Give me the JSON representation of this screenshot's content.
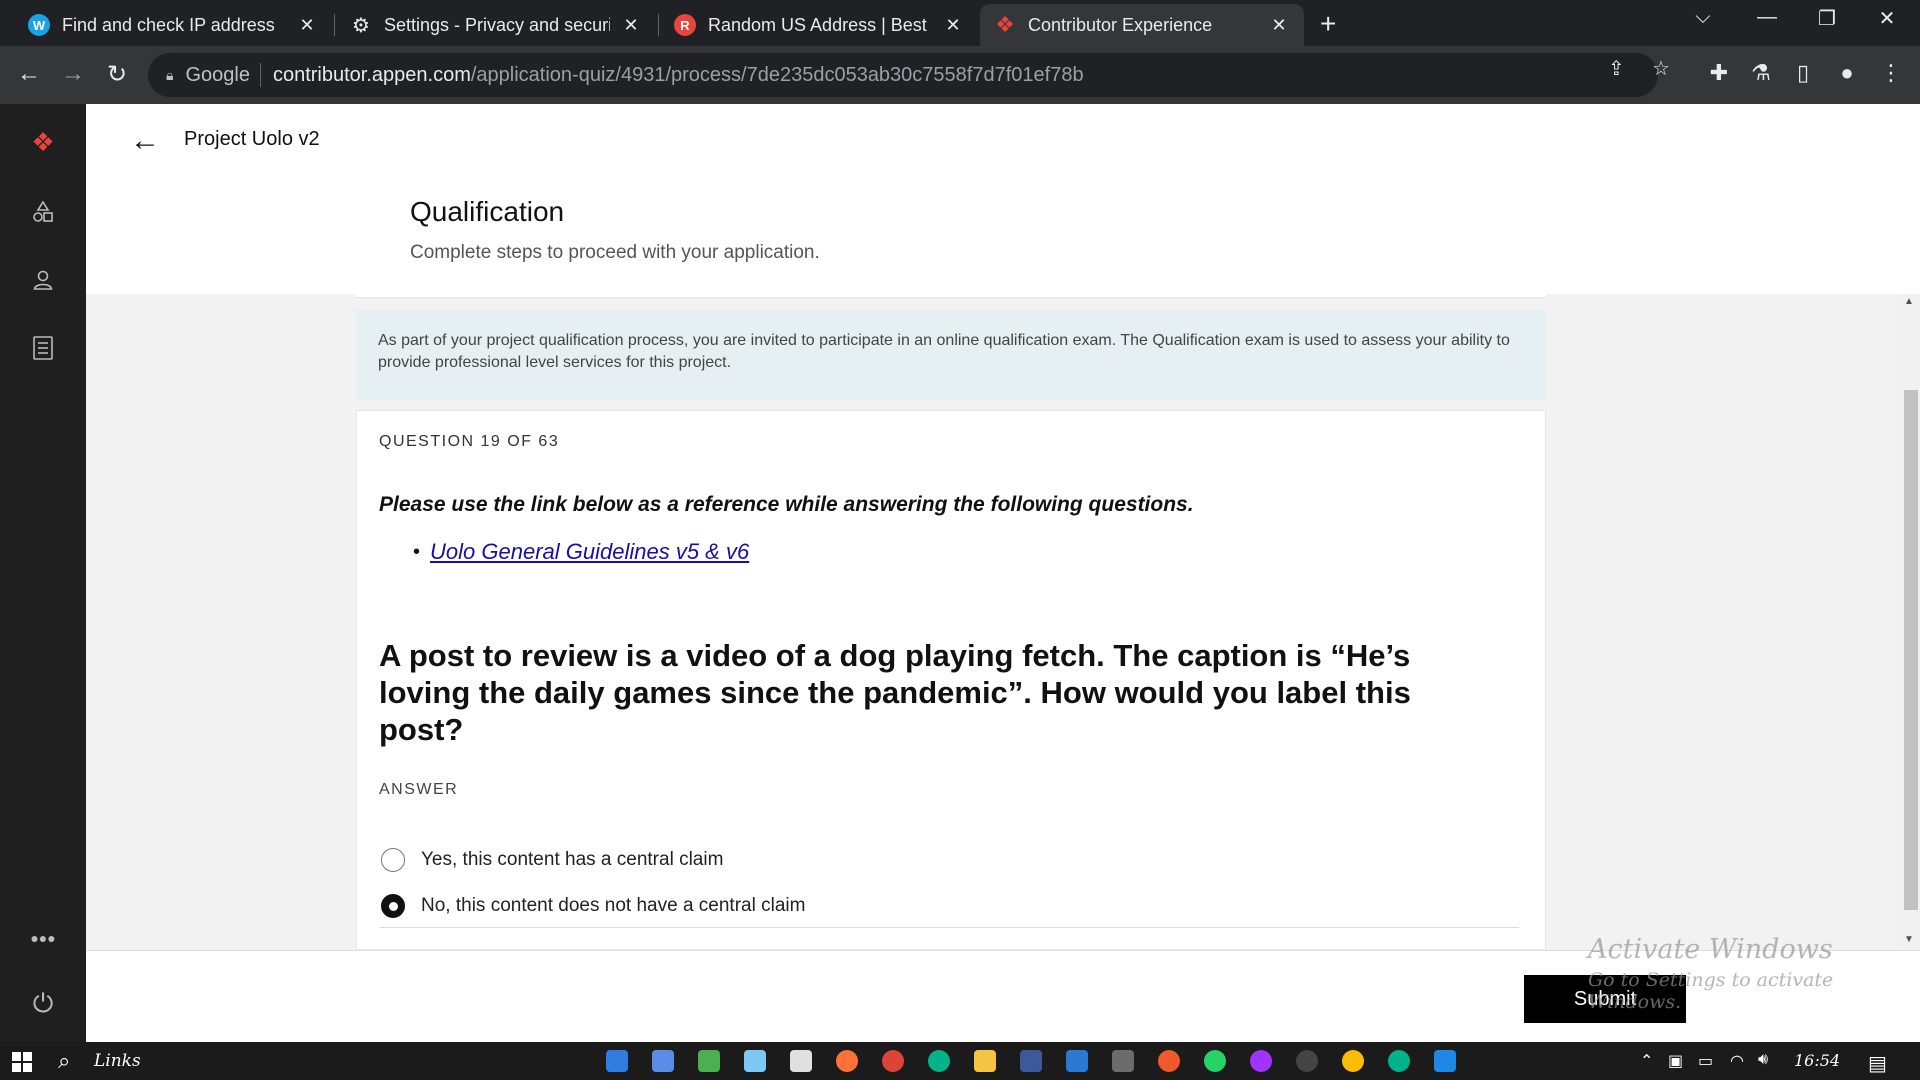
{
  "browser": {
    "tabs": [
      {
        "title": "Find and check IP address",
        "favicon": "W",
        "favicon_color": "#19a2e6"
      },
      {
        "title": "Settings - Privacy and security",
        "favicon": "⚙",
        "favicon_color": "#35363a"
      },
      {
        "title": "Random US Address | Best Random",
        "favicon": "R",
        "favicon_color": "#e8453c"
      },
      {
        "title": "Contributor Experience",
        "favicon": "❖",
        "favicon_color": "#35363a"
      }
    ],
    "address": {
      "prefix": "Google",
      "domain": "contributor.appen.com",
      "path": "/application-quiz/4931/process/7de235dc053ab30c7558f7d7f01ef78b"
    }
  },
  "page": {
    "project_title": "Project Uolo v2",
    "qualification_title": "Qualification",
    "qualification_subtitle": "Complete steps to proceed with your application.",
    "info_text": "As part of your project qualification process, you are invited to participate in an online qualification exam. The Qualification exam is used to assess your ability to provide professional level services for this project.",
    "question_counter": "QUESTION 19 OF 63",
    "reference_text": "Please use the link below as a reference while answering the following questions.",
    "reference_link": "Uolo General Guidelines v5 & v6",
    "question_text": "A post to review is a video of a dog playing fetch. The caption is “He’s loving the daily games since the pandemic”. How would you label this post?",
    "answer_label": "ANSWER",
    "options": [
      {
        "label": "Yes, this content has a central claim",
        "selected": false
      },
      {
        "label": "No, this content does not have a central claim",
        "selected": true
      }
    ],
    "submit_label": "Submit"
  },
  "watermark": {
    "line1": "Activate Windows",
    "line2": "Go to Settings to activate Windows."
  },
  "taskbar": {
    "links_label": "Links",
    "clock": "16:54"
  },
  "colors": {
    "brand": "#e8453c",
    "info_bg": "#e6eff2",
    "link": "#1a0dab"
  }
}
